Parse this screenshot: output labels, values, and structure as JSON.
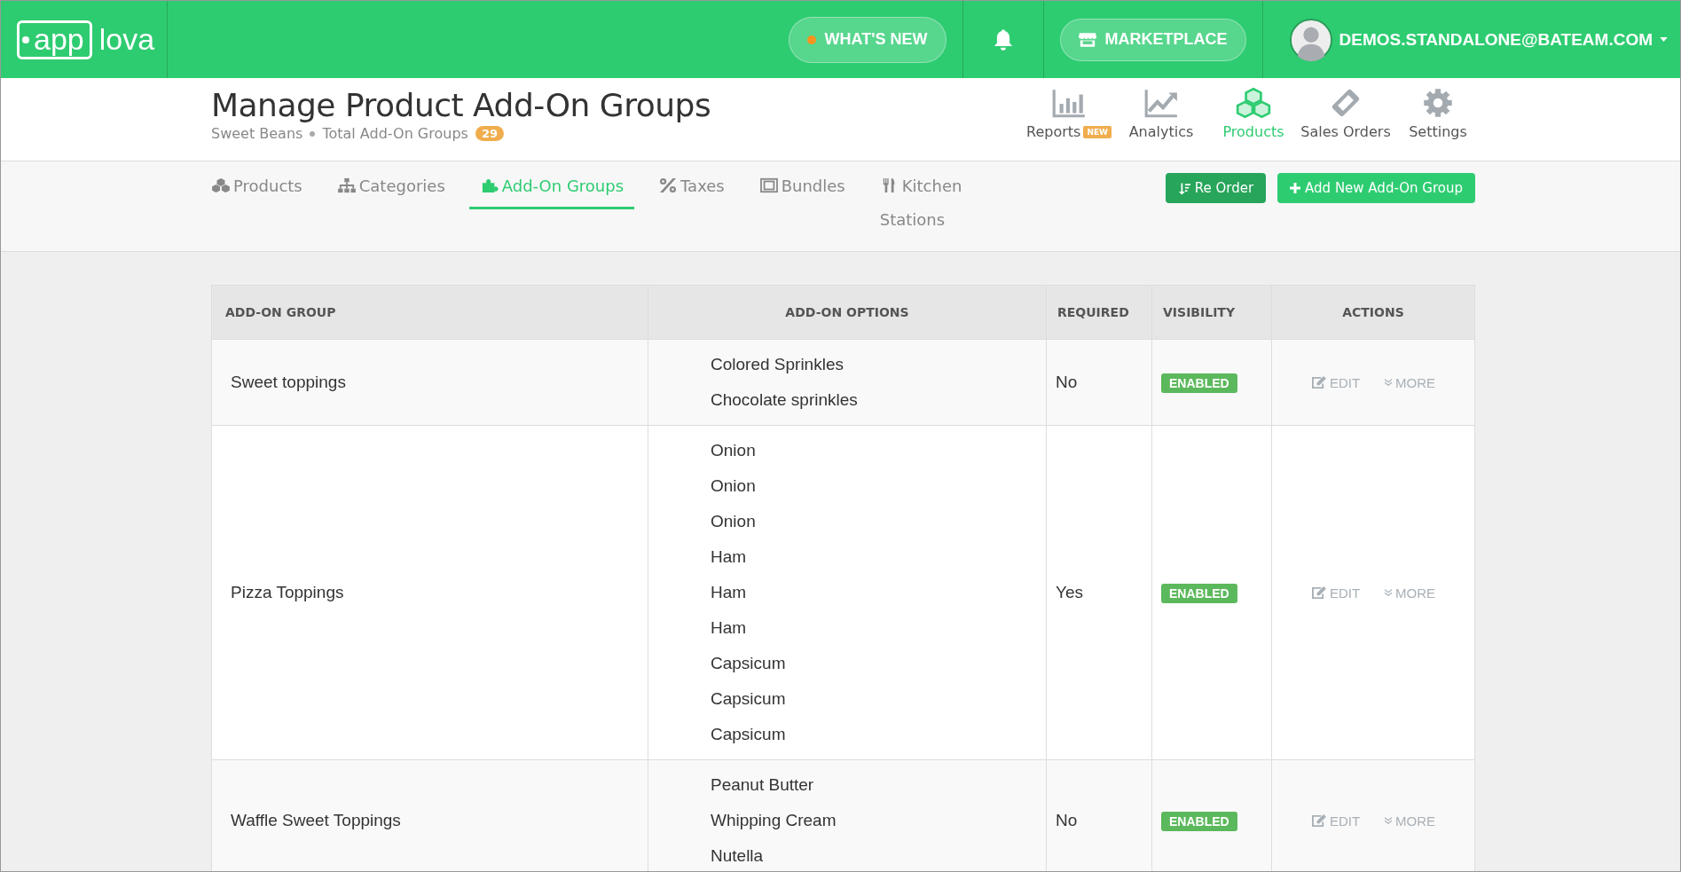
{
  "header": {
    "logo": {
      "boxed": "app",
      "rest": "lova"
    },
    "whats_new": {
      "label": "WHAT'S NEW",
      "unread": true
    },
    "marketplace": {
      "label": "MARKETPLACE"
    },
    "user": {
      "email": "DEMOS.STANDALONE@BATEAM.COM"
    }
  },
  "page": {
    "title": "Manage Product Add-On Groups",
    "store": "Sweet Beans",
    "total_label": "Total Add-On Groups",
    "total_count": "29"
  },
  "nav": [
    {
      "label": "Reports",
      "badge": "NEW",
      "selected": false
    },
    {
      "label": "Analytics",
      "selected": false
    },
    {
      "label": "Products",
      "selected": true
    },
    {
      "label": "Sales Orders",
      "selected": false
    },
    {
      "label": "Settings",
      "selected": false
    }
  ],
  "tabs": [
    {
      "label": "Products",
      "selected": false
    },
    {
      "label": "Categories",
      "selected": false
    },
    {
      "label": "Add-On Groups",
      "selected": true
    },
    {
      "label": "Taxes",
      "selected": false
    },
    {
      "label": "Bundles",
      "selected": false
    },
    {
      "label": "Kitchen Stations",
      "selected": false
    }
  ],
  "buttons": [
    {
      "label": "Re Order",
      "kind": "reorder"
    },
    {
      "label": "Add New Add-On Group",
      "kind": "add"
    }
  ],
  "table": {
    "columns": [
      "ADD-ON GROUP",
      "ADD-ON OPTIONS",
      "REQUIRED",
      "VISIBILITY",
      "ACTIONS"
    ],
    "rows": [
      {
        "group": "Sweet toppings",
        "options": [
          "Colored Sprinkles",
          "Chocolate sprinkles"
        ],
        "required": "No",
        "visibility": {
          "label": "ENABLED",
          "enabled": true
        },
        "actions": [
          "EDIT",
          "MORE"
        ]
      },
      {
        "group": "Pizza Toppings",
        "options": [
          "Onion",
          "Onion",
          "Onion",
          "Ham",
          "Ham",
          "Ham",
          "Capsicum",
          "Capsicum",
          "Capsicum"
        ],
        "required": "Yes",
        "visibility": {
          "label": "ENABLED",
          "enabled": true
        },
        "actions": [
          "EDIT",
          "MORE"
        ]
      },
      {
        "group": "Waffle Sweet Toppings",
        "options": [
          "Peanut Butter",
          "Whipping Cream",
          "Nutella"
        ],
        "required": "No",
        "visibility": {
          "label": "ENABLED",
          "enabled": true
        },
        "actions": [
          "EDIT",
          "MORE"
        ]
      }
    ]
  }
}
